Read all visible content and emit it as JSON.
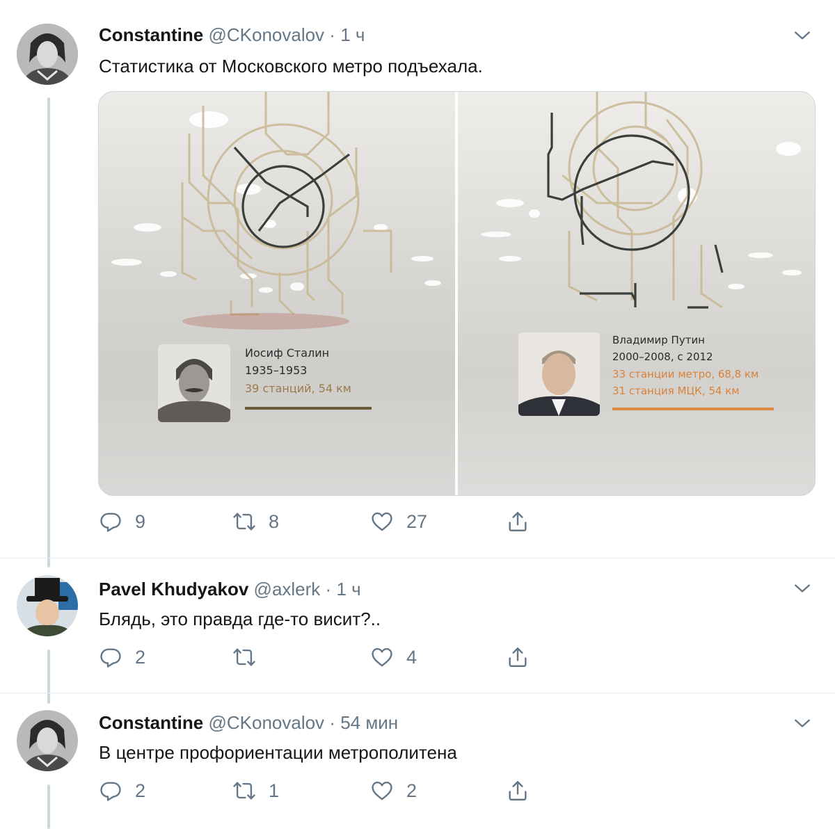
{
  "tweets": [
    {
      "name": "Constantine",
      "handle": "@CKonovalov",
      "separator": "·",
      "time": "1 ч",
      "text": "Статистика от Московского метро подъехала.",
      "replies": "9",
      "retweets": "8",
      "likes": "27"
    },
    {
      "name": "Pavel Khudyakov",
      "handle": "@axlerk",
      "separator": "·",
      "time": "1 ч",
      "text": "Блядь, это правда где-то висит?..",
      "replies": "2",
      "retweets": "",
      "likes": "4"
    },
    {
      "name": "Constantine",
      "handle": "@CKonovalov",
      "separator": "·",
      "time": "54 мин",
      "text": "В центре профориентации метрополитена",
      "replies": "2",
      "retweets": "1",
      "likes": "2"
    }
  ],
  "media": {
    "left": {
      "name": "Иосиф Сталин",
      "years": "1935–1953",
      "stats": "39 станций, 54 км"
    },
    "right": {
      "name": "Владимир Путин",
      "years": "2000–2008, с 2012",
      "stats1": "33 станции метро, 68,8 км",
      "stats2": "31 станция МЦК, 54 км"
    }
  },
  "icons": {
    "reply": "reply-icon",
    "retweet": "retweet-icon",
    "like": "heart-icon",
    "share": "share-icon",
    "menu": "chevron-down-icon"
  },
  "colors": {
    "text": "#14171a",
    "secondary": "#657786",
    "thread_line": "#ccd6dd"
  }
}
